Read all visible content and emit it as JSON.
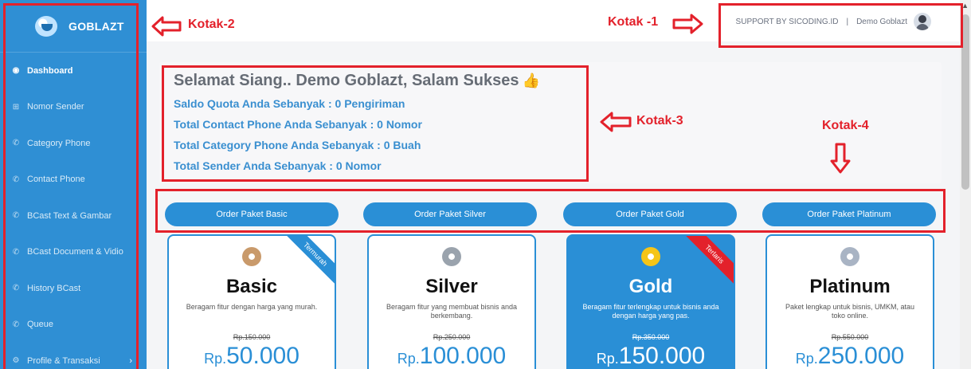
{
  "brand": {
    "name": "GOBLAZT"
  },
  "sidebar": {
    "items": [
      {
        "label": "Dashboard",
        "icon": "dashboard-icon",
        "active": true
      },
      {
        "label": "Nomor Sender",
        "icon": "grid-icon"
      },
      {
        "label": "Category Phone",
        "icon": "phone-icon"
      },
      {
        "label": "Contact Phone",
        "icon": "phone-icon"
      },
      {
        "label": "BCast Text & Gambar",
        "icon": "phone-icon"
      },
      {
        "label": "BCast Document & Vidio",
        "icon": "phone-icon"
      },
      {
        "label": "History BCast",
        "icon": "phone-icon"
      },
      {
        "label": "Queue",
        "icon": "phone-icon"
      },
      {
        "label": "Profile & Transaksi",
        "icon": "gear-icon",
        "has_children": true
      }
    ]
  },
  "topbar": {
    "support_text": "SUPPORT BY SICODING.ID",
    "separator": "|",
    "user_name": "Demo Goblazt"
  },
  "greeting": {
    "title": "Selamat Siang.. Demo Goblazt, Salam Sukses",
    "lines": [
      "Saldo Quota Anda Sebanyak : 0 Pengiriman",
      "Total Contact Phone Anda Sebanyak : 0 Nomor",
      "Total Category Phone Anda Sebanyak : 0 Buah",
      "Total Sender Anda Sebanyak : 0 Nomor"
    ]
  },
  "order_buttons": [
    "Order Paket Basic",
    "Order Paket Silver",
    "Order Paket Gold",
    "Order Paket Platinum"
  ],
  "plans": [
    {
      "name": "Basic",
      "desc": "Beragam fitur dengan harga yang murah.",
      "old_price": "Rp.150.000",
      "currency": "Rp.",
      "price": "50.000",
      "ribbon": "Termurah",
      "ribbon_color": "#2a8fd6",
      "medal_color": "#c99a6b",
      "featured": false
    },
    {
      "name": "Silver",
      "desc": "Beragam fitur yang membuat bisnis anda berkembang.",
      "old_price": "Rp.250.000",
      "currency": "Rp.",
      "price": "100.000",
      "ribbon": "",
      "medal_color": "#9aa3ad",
      "featured": false
    },
    {
      "name": "Gold",
      "desc": "Beragam fitur terlengkap untuk bisnis anda dengan harga yang pas.",
      "old_price": "Rp.350.000",
      "currency": "Rp.",
      "price": "150.000",
      "ribbon": "Terlaris",
      "ribbon_color": "#e3212b",
      "medal_color": "#f5c518",
      "featured": true
    },
    {
      "name": "Platinum",
      "desc": "Paket lengkap untuk bisnis, UMKM, atau toko online.",
      "old_price": "Rp.550.000",
      "currency": "Rp.",
      "price": "250.000",
      "ribbon": "",
      "medal_color": "#a9b4c4",
      "featured": false
    }
  ],
  "annotations": [
    {
      "label": "Kotak -1"
    },
    {
      "label": "Kotak-2"
    },
    {
      "label": "Kotak-3"
    },
    {
      "label": "Kotak-4"
    }
  ],
  "colors": {
    "accent": "#2a8fd6",
    "annotation": "#e3212b",
    "sidebar": "#2f8fd4"
  }
}
